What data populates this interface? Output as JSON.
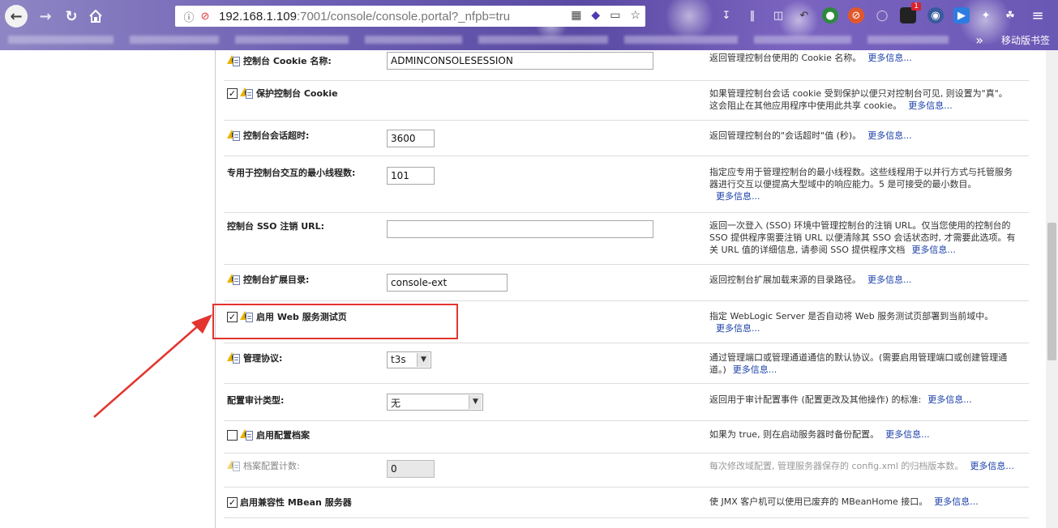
{
  "browser": {
    "url_host": "192.168.1.109",
    "url_path": ":7001/console/console.portal?_nfpb=tru",
    "mobile_bookmarks": "移动版书签",
    "extension_badge": "1"
  },
  "rows": [
    {
      "label": "控制台 Cookie 名称:",
      "field_value": "ADMINCONSOLESESSION",
      "desc": "返回管理控制台使用的 Cookie 名称。",
      "more": "更多信息..."
    },
    {
      "label": "保护控制台 Cookie",
      "checked": true,
      "desc": "如果管理控制台会话 cookie 受到保护以便只对控制台可见, 则设置为\"真\"。这会阻止在其他应用程序中使用此共享 cookie。",
      "more": "更多信息..."
    },
    {
      "label": "控制台会话超时:",
      "field_value": "3600",
      "desc": "返回管理控制台的\"会话超时\"值 (秒)。",
      "more": "更多信息..."
    },
    {
      "label": "专用于控制台交互的最小线程数:",
      "field_value": "101",
      "desc": "指定应专用于管理控制台的最小线程数。这些线程用于以并行方式与托管服务器进行交互以便提高大型域中的响应能力。5 是可接受的最小数目。",
      "more": "更多信息..."
    },
    {
      "label": "控制台 SSO 注销 URL:",
      "field_value": "",
      "desc": "返回一次登入 (SSO) 环境中管理控制台的注销 URL。仅当您使用的控制台的 SSO 提供程序需要注销 URL 以便清除其 SSO 会话状态时, 才需要此选项。有关 URL 值的详细信息, 请参阅 SSO 提供程序文档",
      "more": "更多信息..."
    },
    {
      "label": "控制台扩展目录:",
      "field_value": "console-ext",
      "desc": "返回控制台扩展加载来源的目录路径。",
      "more": "更多信息..."
    },
    {
      "label": "启用 Web 服务测试页",
      "checked": true,
      "desc": "指定 WebLogic Server 是否自动将 Web 服务测试页部署到当前域中。",
      "more": "更多信息..."
    },
    {
      "label": "管理协议:",
      "field_value": "t3s",
      "desc": "通过管理端口或管理通道通信的默认协议。(需要启用管理端口或创建管理通道。)",
      "more": "更多信息..."
    },
    {
      "label": "配置审计类型:",
      "field_value": "无",
      "desc": "返回用于审计配置事件 (配置更改及其他操作) 的标准:",
      "more": "更多信息..."
    },
    {
      "label": "启用配置档案",
      "checked": false,
      "desc": "如果为 true, 则在启动服务器时备份配置。",
      "more": "更多信息..."
    },
    {
      "label": "档案配置计数:",
      "field_value": "0",
      "desc": "每次修改域配置, 管理服务器保存的 config.xml 的归档版本数。",
      "more": "更多信息..."
    },
    {
      "label": "启用兼容性 MBean 服务器",
      "checked": true,
      "desc": "使 JMX 客户机可以使用已废弃的 MBeanHome 接口。",
      "more": "更多信息..."
    }
  ],
  "colors": {
    "annotation": "#e3342f",
    "link": "#1a3fa8"
  }
}
